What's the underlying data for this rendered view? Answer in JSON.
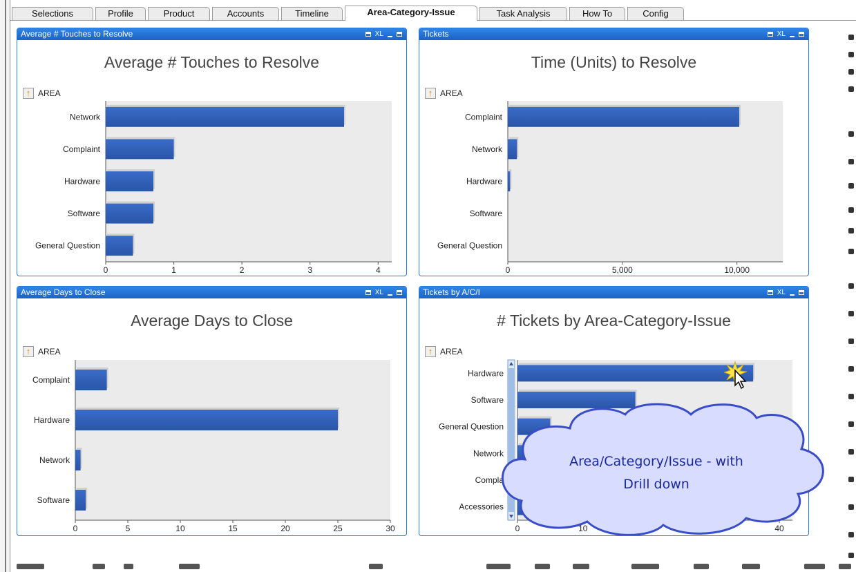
{
  "tabs": [
    {
      "label": "Selections",
      "active": false
    },
    {
      "label": "Profile",
      "active": false
    },
    {
      "label": "Product",
      "active": false
    },
    {
      "label": "Accounts",
      "active": false
    },
    {
      "label": "Timeline",
      "active": false
    },
    {
      "label": "Area-Category-Issue",
      "active": true
    },
    {
      "label": "Task Analysis",
      "active": false
    },
    {
      "label": "How To",
      "active": false
    },
    {
      "label": "Config",
      "active": false
    }
  ],
  "caption_icons": {
    "print": "print-icon",
    "excel": "XL",
    "minimize": "minimize-icon",
    "maximize": "maximize-icon"
  },
  "drill_label": "AREA",
  "callout": {
    "line1": "Area/Category/Issue - with",
    "line2": "Drill down"
  },
  "colors": {
    "bar": "#2a55a8",
    "panel_border": "#2b78d6",
    "caption": "#1f6fd0",
    "plot_bg": "#ebebeb",
    "callout_text": "#1a2a9a",
    "callout_fill": "#d8dcff"
  },
  "panels": [
    {
      "caption": "Average # Touches to Resolve",
      "title": "Average # Touches to Resolve"
    },
    {
      "caption": "Tickets",
      "title": "Time (Units) to Resolve"
    },
    {
      "caption": "Average Days to Close",
      "title": "Average Days to Close"
    },
    {
      "caption": "Tickets by A/C/I",
      "title": "# Tickets by Area-Category-Issue"
    }
  ],
  "chart_data": [
    {
      "type": "bar",
      "orientation": "horizontal",
      "title": "Average # Touches to Resolve",
      "categories": [
        "Network",
        "Complaint",
        "Hardware",
        "Software",
        "General Question"
      ],
      "values": [
        3.5,
        1.0,
        0.7,
        0.7,
        0.4
      ],
      "xlim": [
        0,
        4.2
      ],
      "xticks": [
        0,
        1,
        2,
        3,
        4
      ],
      "xtick_labels": [
        "0",
        "1",
        "2",
        "3",
        "4"
      ]
    },
    {
      "type": "bar",
      "orientation": "horizontal",
      "title": "Time (Units) to Resolve",
      "categories": [
        "Complaint",
        "Network",
        "Hardware",
        "Software",
        "General Question"
      ],
      "values": [
        10100,
        400,
        100,
        0,
        0
      ],
      "xlim": [
        0,
        12000
      ],
      "xticks": [
        0,
        5000,
        10000
      ],
      "xtick_labels": [
        "0",
        "5,000",
        "10,000"
      ]
    },
    {
      "type": "bar",
      "orientation": "horizontal",
      "title": "Average Days to Close",
      "categories": [
        "Complaint",
        "Hardware",
        "Network",
        "Software"
      ],
      "values": [
        3,
        25,
        0.5,
        1
      ],
      "xlim": [
        0,
        30
      ],
      "xticks": [
        0,
        5,
        10,
        15,
        20,
        25,
        30
      ],
      "xtick_labels": [
        "0",
        "5",
        "10",
        "15",
        "20",
        "25",
        "30"
      ]
    },
    {
      "type": "bar",
      "orientation": "horizontal",
      "title": "# Tickets by Area-Category-Issue",
      "categories": [
        "Hardware",
        "Software",
        "General Question",
        "Network",
        "Complaint",
        "Accessories"
      ],
      "category_labels": [
        "Hardware",
        "Software",
        "General Question",
        "Network",
        "Compla",
        "Accessories"
      ],
      "values": [
        36,
        18,
        5,
        3,
        1,
        1
      ],
      "xlim": [
        0,
        42
      ],
      "xticks": [
        0,
        10,
        20,
        30,
        40
      ],
      "xtick_labels": [
        "0",
        "10",
        "",
        "",
        "40"
      ]
    }
  ]
}
